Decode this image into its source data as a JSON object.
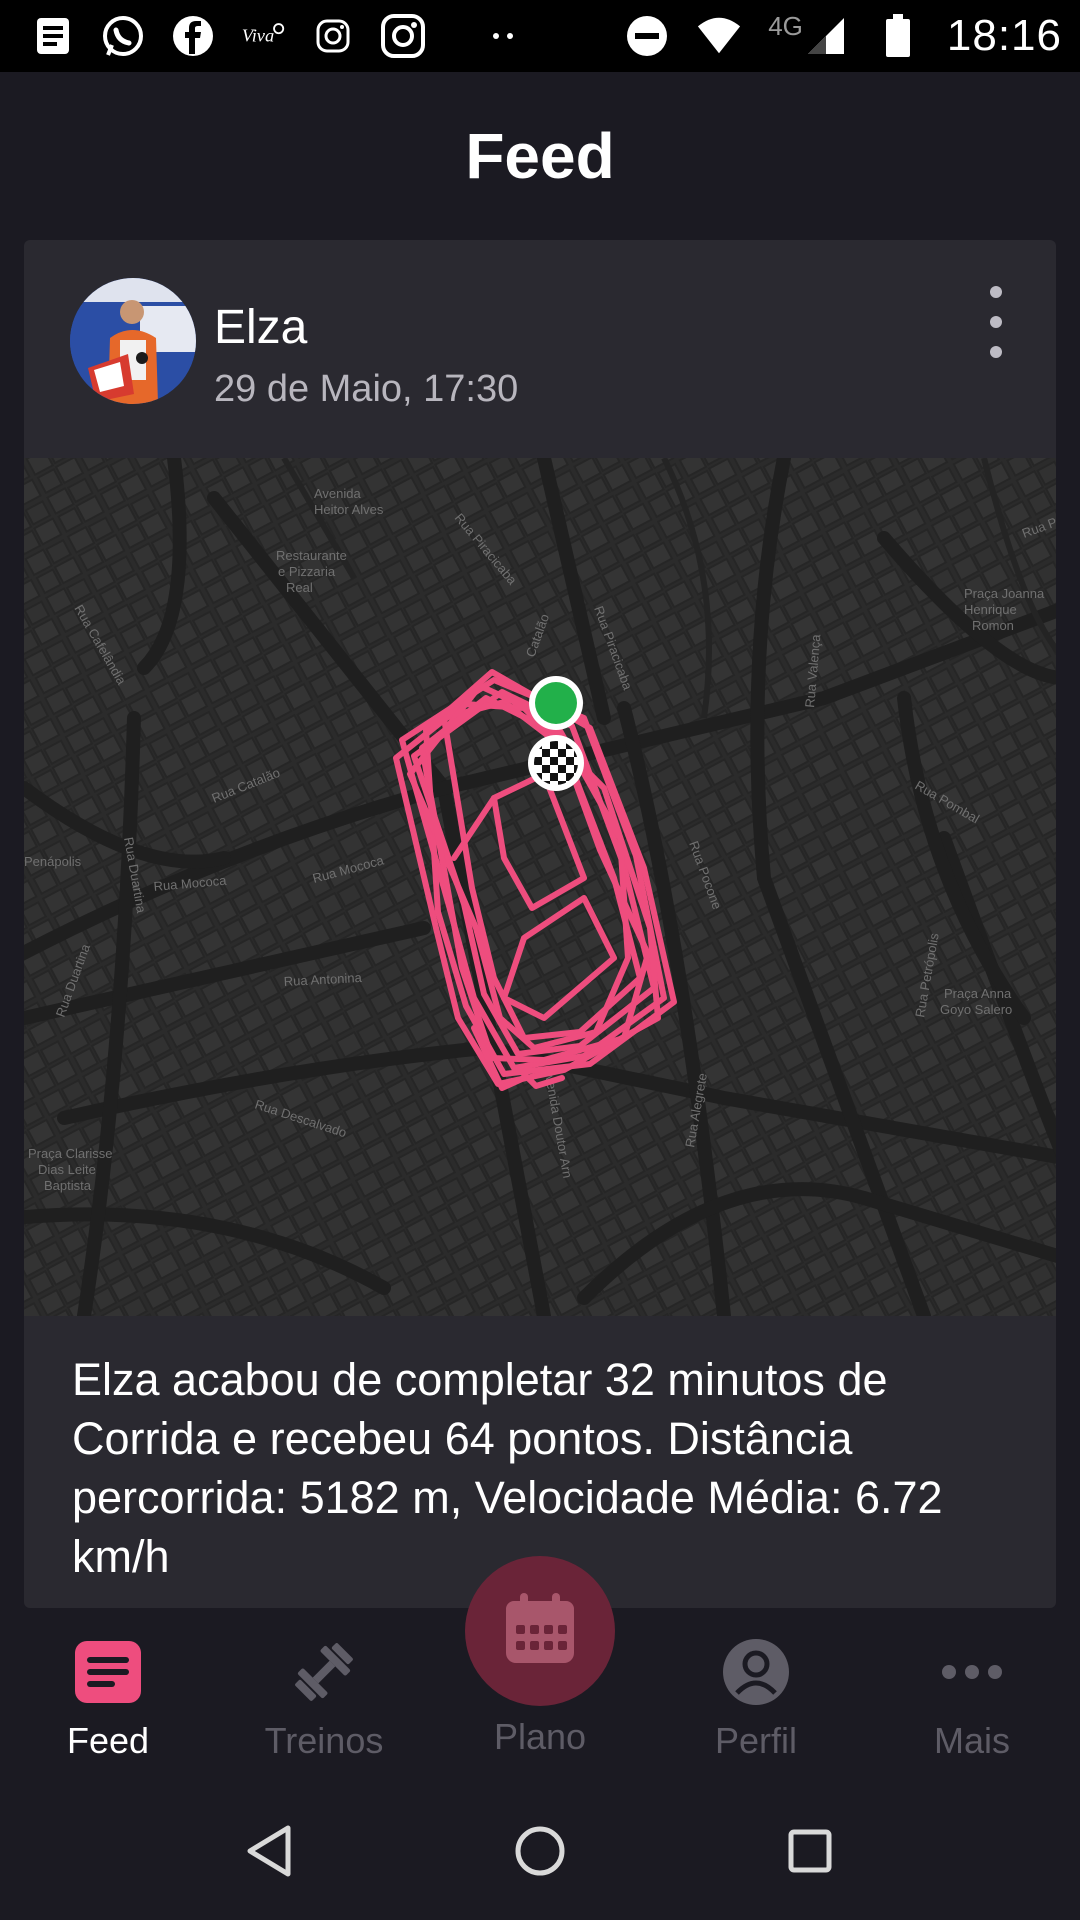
{
  "status_bar": {
    "time": "18:16",
    "network": "4G",
    "left_icons": [
      "news-icon",
      "whatsapp-icon",
      "facebook-icon",
      "viva-icon",
      "instagram-icon",
      "instagram-icon",
      "more-dots-icon"
    ],
    "right_icons": [
      "do-not-disturb-icon",
      "wifi-icon",
      "signal-icon",
      "battery-icon"
    ]
  },
  "header": {
    "title": "Feed"
  },
  "post": {
    "user_name": "Elza",
    "date": "29 de Maio, 17:30",
    "description": "Elza acabou de completar 32 minutos de Corrida e recebeu 64 pontos. Distância percorrida: 5182 m, Velocidade Média: 6.72 km/h",
    "map": {
      "route_color": "#ee4d7e",
      "start_color": "#22b04a",
      "streets": [
        "Rua Piracicaba",
        "Rua Catalão",
        "Rua Valença",
        "Rua Pombal",
        "Rua Pocone",
        "Rua Mococa",
        "Rua Antonina",
        "Rua Descalvado",
        "Rua Duartina",
        "Rua Petrópolis",
        "Rua Alegrete",
        "Avenida Doutor Arn",
        "Rua Caiubi",
        "Rua Cafelândia",
        "Rua Potim",
        "Praça Joanna Henrique Romon",
        "Praça Anna Goyo Salero",
        "Praça Clarisse Dias Leite Baptista",
        "Restaurante e Pizzaria Real",
        "Avenida Heitor Alves",
        "Penápolis"
      ]
    }
  },
  "bottom_nav": {
    "accent": "#ee4d7e",
    "items": [
      {
        "label": "Feed",
        "icon": "feed-icon",
        "active": true
      },
      {
        "label": "Treinos",
        "icon": "dumbbell-icon",
        "active": false
      },
      {
        "label": "Plano",
        "icon": "calendar-icon",
        "active": false
      },
      {
        "label": "Perfil",
        "icon": "profile-icon",
        "active": false
      },
      {
        "label": "Mais",
        "icon": "more-icon",
        "active": false
      }
    ]
  },
  "system_nav": [
    "back-icon",
    "home-icon",
    "recents-icon"
  ]
}
